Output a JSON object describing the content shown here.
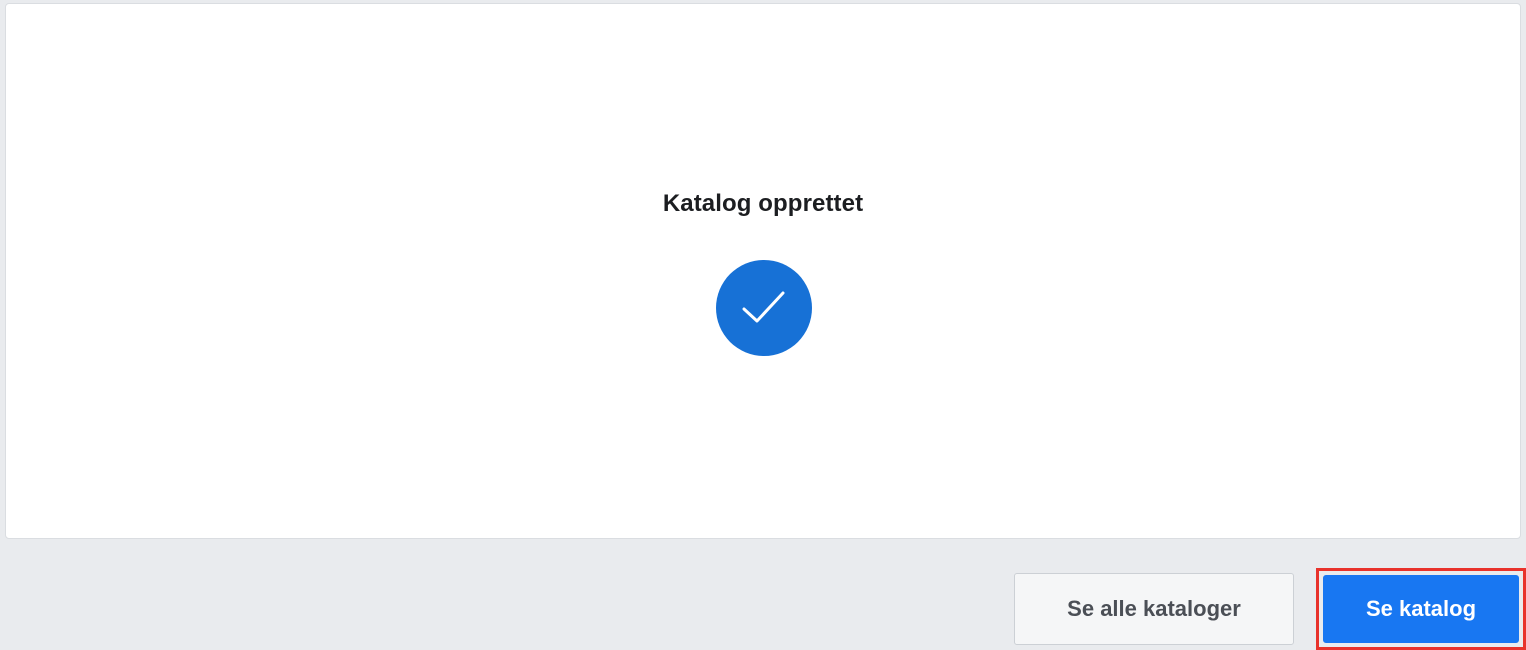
{
  "dialog": {
    "title": "Katalog opprettet",
    "status_icon": "checkmark-circle-icon",
    "accent_color": "#1771d6"
  },
  "footer": {
    "secondary_button_label": "Se alle kataloger",
    "primary_button_label": "Se katalog",
    "primary_color": "#1877f2",
    "highlight_color": "#e8322b"
  }
}
